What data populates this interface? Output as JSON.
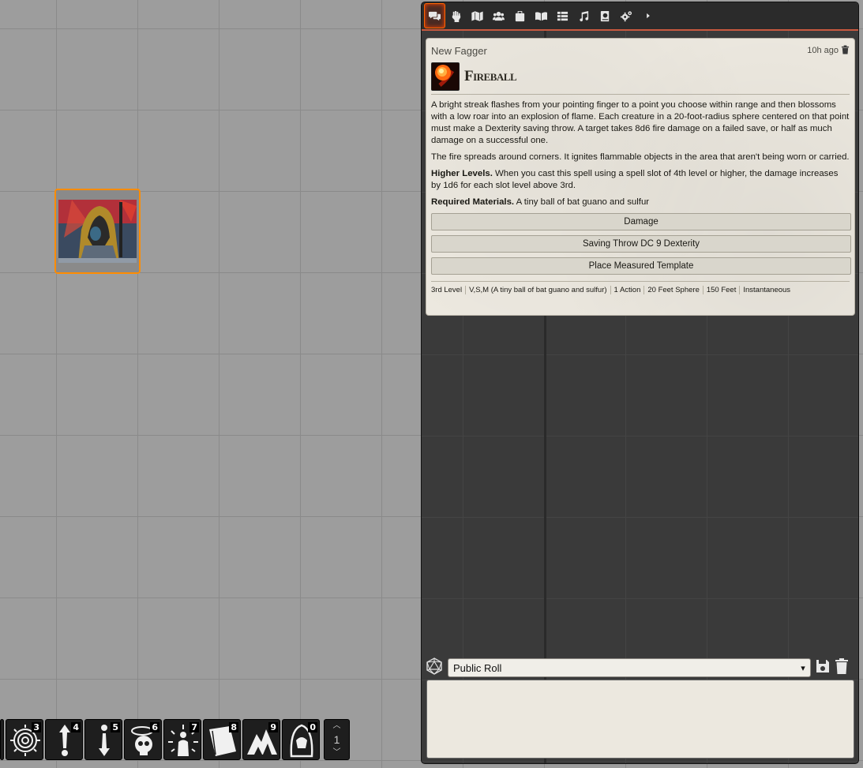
{
  "sidebar": {
    "tabs": [
      {
        "name": "chat"
      },
      {
        "name": "combat"
      },
      {
        "name": "scenes"
      },
      {
        "name": "actors"
      },
      {
        "name": "items"
      },
      {
        "name": "journal"
      },
      {
        "name": "tables"
      },
      {
        "name": "playlists"
      },
      {
        "name": "compendium"
      },
      {
        "name": "settings"
      },
      {
        "name": "more"
      }
    ]
  },
  "message": {
    "sender": "New Fagger",
    "timestamp": "10h ago",
    "spell_name": "Fireball",
    "desc_1": "A bright streak flashes from your pointing finger to a point you choose within range and then blossoms with a low roar into an explosion of flame. Each creature in a 20-foot-radius sphere centered on that point must make a Dexterity saving throw. A target takes 8d6 fire damage on a failed save, or half as much damage on a successful one.",
    "desc_2": "The fire spreads around corners. It ignites flammable objects in the area that aren't being worn or carried.",
    "higher_label": "Higher Levels.",
    "higher_text": " When you cast this spell using a spell slot of 4th level or higher, the damage increases by 1d6 for each slot level above 3rd.",
    "materials_label": "Required Materials.",
    "materials_text": " A tiny ball of bat guano and sulfur",
    "buttons": {
      "damage": "Damage",
      "save": "Saving Throw DC 9 Dexterity",
      "template": "Place Measured Template"
    },
    "tags": [
      "3rd Level",
      "V,S,M (A tiny ball of bat guano and sulfur)",
      "1 Action",
      "20 Feet Sphere",
      "150 Feet",
      "Instantaneous"
    ]
  },
  "roll": {
    "mode": "Public Roll"
  },
  "hotbar": {
    "slots": [
      {
        "num": "3"
      },
      {
        "num": "4"
      },
      {
        "num": "5"
      },
      {
        "num": "6"
      },
      {
        "num": "7"
      },
      {
        "num": "8"
      },
      {
        "num": "9"
      },
      {
        "num": "0"
      }
    ],
    "page": "1"
  },
  "colors": {
    "accent": "#ff6400",
    "canvas": "#9d9d9d",
    "card": "#ece8df",
    "token_border": "#ff8c00"
  }
}
